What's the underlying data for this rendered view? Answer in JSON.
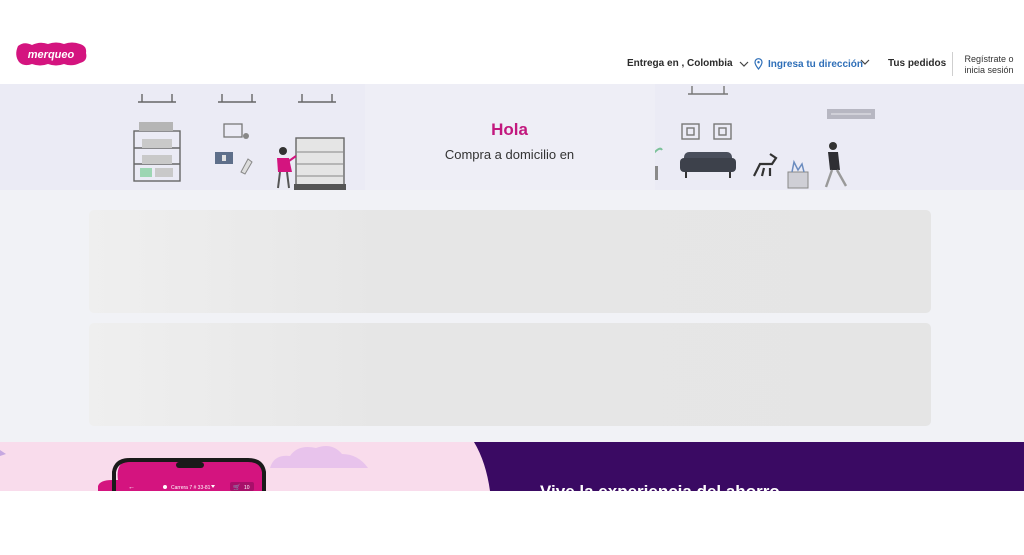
{
  "brand": {
    "name": "merqueo"
  },
  "header": {
    "delivery_label": "Entrega en , Colombia",
    "address_label": "Ingresa tu dirección",
    "orders_label": "Tus pedidos",
    "login_line1": "Regístrate o",
    "login_line2": "inicia sesión"
  },
  "hero": {
    "title": "Hola",
    "subtitle": "Compra a domicilio en"
  },
  "phone": {
    "address": "Carrera 7 # 33-81",
    "cart_count": "10"
  },
  "promo": {
    "heading": "Vive la experiencia del ahorro"
  },
  "colors": {
    "brand_pink": "#c2187e",
    "link_blue": "#2f6fb8",
    "hero_bg": "#ebebf5",
    "promo_purple": "#3a0a63"
  }
}
